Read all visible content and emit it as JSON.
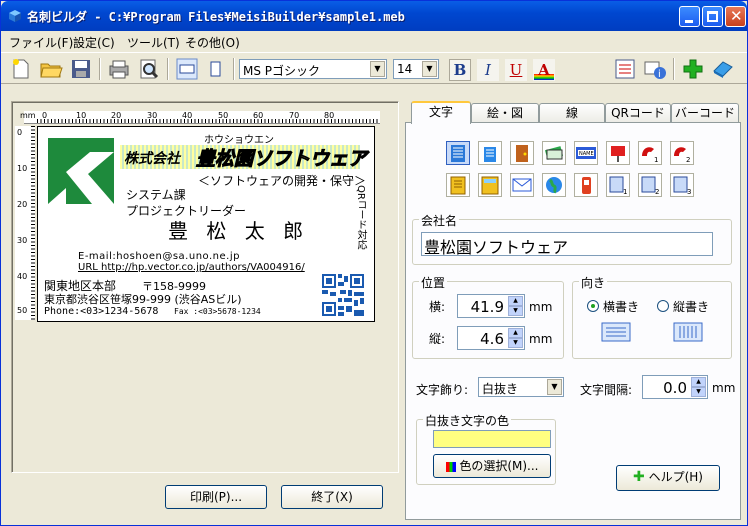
{
  "window": {
    "title": "名刺ビルダ - C:¥Program Files¥MeisiBuilder¥sample1.meb"
  },
  "menu": [
    "ファイル(F)",
    "設定(C)",
    "ツール(T)",
    "その他(O)"
  ],
  "toolbar": {
    "font_name": "MS Pゴシック",
    "font_size": "14",
    "bold": "B",
    "italic": "I",
    "underline": "U",
    "color_letter": "A"
  },
  "card": {
    "furigana": "ホウショウエン",
    "company_prefix": "株式会社",
    "company_name": "豊松園ソフトウェア",
    "tagline": "＜ソフトウェアの開発・保守＞",
    "department": "システム課",
    "position": "プロジェクトリーダー",
    "name": "豊 松 太 郎",
    "qr_note": "QRコード対応",
    "email": "E-mail:hoshoen@sa.uno.ne.jp",
    "url": "URL http://hp.vector.co.jp/authors/VA004916/",
    "office": "関東地区本部",
    "postal": "〒158-9999",
    "address": "東京都渋谷区笹塚99-999 (渋谷ASビル)",
    "phone": "Phone:<03>1234-5678",
    "fax": "Fax  :<03>5678-1234"
  },
  "ruler": {
    "unit": "mm",
    "h_ticks": [
      "0",
      "10",
      "20",
      "30",
      "40",
      "50",
      "60",
      "70",
      "80"
    ],
    "v_ticks": [
      "0",
      "10",
      "20",
      "30",
      "40",
      "50"
    ]
  },
  "buttons": {
    "print": "印刷(P)...",
    "exit": "終了(X)",
    "help": "ヘルプ(H)",
    "color_select": "色の選択(M)..."
  },
  "tabs": [
    "文字",
    "絵・図",
    "線",
    "QRコード",
    "バーコード"
  ],
  "panel": {
    "company_label": "会社名",
    "company_value": "豊松園ソフトウェア",
    "position_label": "位置",
    "x_label": "横:",
    "x_value": "41.9",
    "y_label": "縦:",
    "y_value": "4.6",
    "unit": "mm",
    "direction_label": "向き",
    "horizontal": "横書き",
    "vertical": "縦書き",
    "deco_label": "文字飾り:",
    "deco_value": "白抜き",
    "spacing_label": "文字間隔:",
    "spacing_value": "0.0",
    "outline_color_label": "白抜き文字の色",
    "outline_color": "#ffff80"
  },
  "colors": {
    "title_bar": "#0a5ee6",
    "logo_green": "#1e8a3c",
    "highlight": "#ffff80"
  }
}
